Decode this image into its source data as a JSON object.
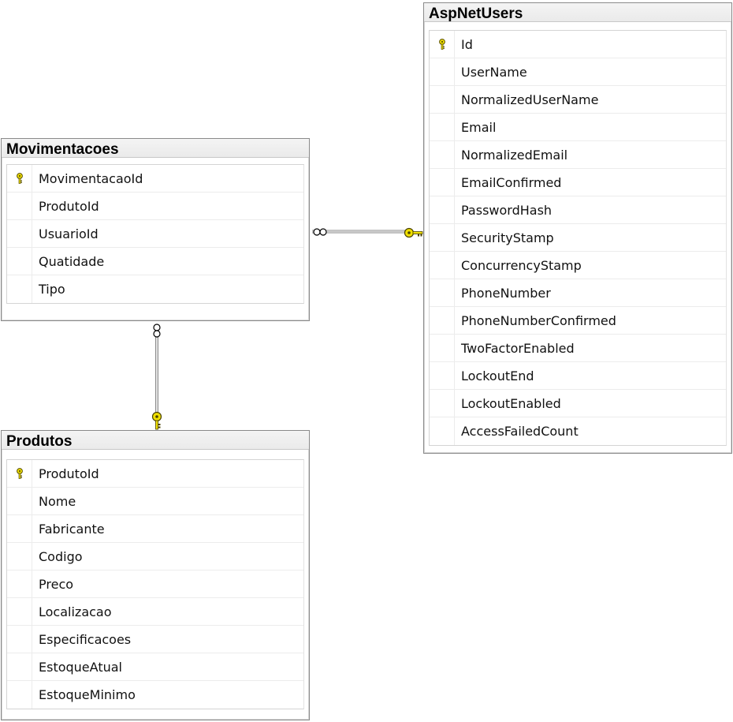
{
  "tables": [
    {
      "id": "movimentacoes",
      "title": "Movimentacoes",
      "columns": [
        {
          "name": "MovimentacaoId",
          "primary_key": true
        },
        {
          "name": "ProdutoId",
          "primary_key": false
        },
        {
          "name": "UsuarioId",
          "primary_key": false
        },
        {
          "name": "Quatidade",
          "primary_key": false
        },
        {
          "name": "Tipo",
          "primary_key": false
        }
      ]
    },
    {
      "id": "aspnetusers",
      "title": "AspNetUsers",
      "columns": [
        {
          "name": "Id",
          "primary_key": true
        },
        {
          "name": "UserName",
          "primary_key": false
        },
        {
          "name": "NormalizedUserName",
          "primary_key": false
        },
        {
          "name": "Email",
          "primary_key": false
        },
        {
          "name": "NormalizedEmail",
          "primary_key": false
        },
        {
          "name": "EmailConfirmed",
          "primary_key": false
        },
        {
          "name": "PasswordHash",
          "primary_key": false
        },
        {
          "name": "SecurityStamp",
          "primary_key": false
        },
        {
          "name": "ConcurrencyStamp",
          "primary_key": false
        },
        {
          "name": "PhoneNumber",
          "primary_key": false
        },
        {
          "name": "PhoneNumberConfirmed",
          "primary_key": false
        },
        {
          "name": "TwoFactorEnabled",
          "primary_key": false
        },
        {
          "name": "LockoutEnd",
          "primary_key": false
        },
        {
          "name": "LockoutEnabled",
          "primary_key": false
        },
        {
          "name": "AccessFailedCount",
          "primary_key": false
        }
      ]
    },
    {
      "id": "produtos",
      "title": "Produtos",
      "columns": [
        {
          "name": "ProdutoId",
          "primary_key": true
        },
        {
          "name": "Nome",
          "primary_key": false
        },
        {
          "name": "Fabricante",
          "primary_key": false
        },
        {
          "name": "Codigo",
          "primary_key": false
        },
        {
          "name": "Preco",
          "primary_key": false
        },
        {
          "name": "Localizacao",
          "primary_key": false
        },
        {
          "name": "Especificacoes",
          "primary_key": false
        },
        {
          "name": "EstoqueAtual",
          "primary_key": false
        },
        {
          "name": "EstoqueMinimo",
          "primary_key": false
        }
      ]
    }
  ],
  "relationships": [
    {
      "from": "movimentacoes",
      "to": "aspnetusers",
      "from_end": "many",
      "to_end": "one"
    },
    {
      "from": "movimentacoes",
      "to": "produtos",
      "from_end": "many",
      "to_end": "one"
    }
  ],
  "colors": {
    "key_icon": "#f0e000",
    "key_outline": "#5a5000",
    "relationship_line": "#808080"
  },
  "icons": {
    "primary_key": "key-icon",
    "one_end": "key-icon",
    "many_end": "infinity-icon"
  }
}
